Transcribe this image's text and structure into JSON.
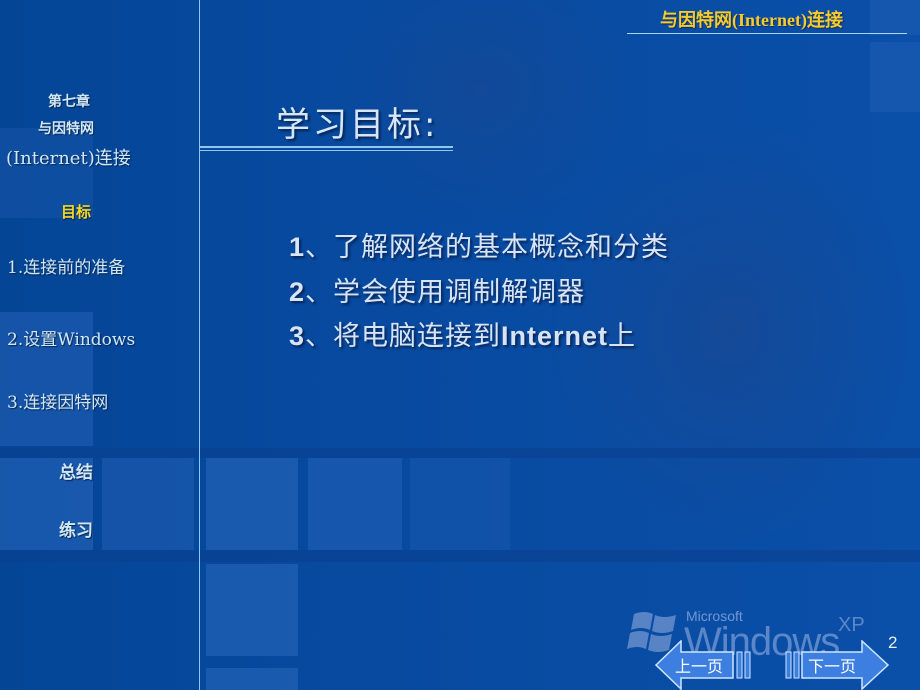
{
  "header": {
    "title": "与因特网(Internet)连接"
  },
  "sidebar": {
    "chapter": {
      "line1": "第七章",
      "line2": "与因特网",
      "line3": "(Internet)连接"
    },
    "items": [
      {
        "label": "目标",
        "active": true
      },
      {
        "label": "1.连接前的准备"
      },
      {
        "label": "2.设置Windows"
      },
      {
        "label": "3.连接因特网"
      },
      {
        "label": "总结"
      },
      {
        "label": "练习"
      }
    ]
  },
  "main": {
    "title": "学习目标:",
    "goals": [
      {
        "num": "1",
        "sep": "、",
        "text": "了解网络的基本概念和分类"
      },
      {
        "num": "2",
        "sep": "、",
        "text": "学会使用调制解调器"
      },
      {
        "num": "3",
        "sep": "、",
        "text": "将电脑连接到",
        "bold": "Internet",
        "tail": "上"
      }
    ]
  },
  "watermark": {
    "brand": "Microsoft",
    "product": "Windows",
    "edition": "XP"
  },
  "footer": {
    "prev_label": "上一页",
    "next_label": "下一页",
    "page_number": "2"
  },
  "colors": {
    "background": "#064399",
    "header_text": "#f3cc2e",
    "active_item": "#f7d81c",
    "sidebar_text": "#cfe8f6",
    "button_fill": "#3d7fe0"
  }
}
